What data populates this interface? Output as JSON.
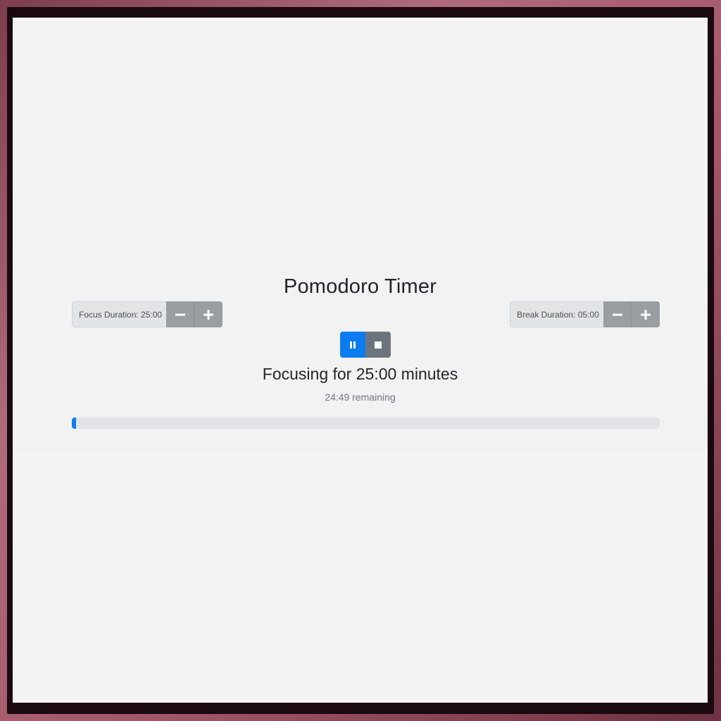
{
  "app": {
    "title": "Pomodoro Timer"
  },
  "focus": {
    "label": "Focus Duration: 25:00",
    "decrement_icon": "minus-icon",
    "increment_icon": "plus-icon"
  },
  "break": {
    "label": "Break Duration: 05:00",
    "decrement_icon": "minus-icon",
    "increment_icon": "plus-icon"
  },
  "controls": {
    "pause_icon": "pause-icon",
    "stop_icon": "stop-icon"
  },
  "status": {
    "text": "Focusing for 25:00 minutes",
    "remaining": "24:49 remaining"
  },
  "progress": {
    "fraction": 0.0073
  },
  "colors": {
    "primary": "#0a7cf0",
    "secondary": "#6c757d",
    "button_gray": "#999ea3",
    "frame": "#a35b6b"
  }
}
